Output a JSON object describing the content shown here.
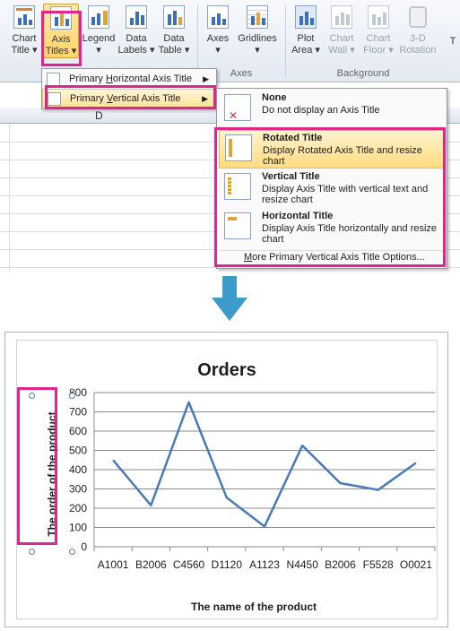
{
  "ribbon": {
    "buttons": [
      {
        "label1": "Chart",
        "label2": "Title ▾"
      },
      {
        "label1": "Axis",
        "label2": "Titles ▾"
      },
      {
        "label1": "Legend",
        "label2": "▾"
      },
      {
        "label1": "Data",
        "label2": "Labels ▾"
      },
      {
        "label1": "Data",
        "label2": "Table ▾"
      },
      {
        "label1": "Axes",
        "label2": "▾"
      },
      {
        "label1": "Gridlines",
        "label2": "▾"
      },
      {
        "label1": "Plot",
        "label2": "Area ▾"
      },
      {
        "label1": "Chart",
        "label2": "Wall ▾"
      },
      {
        "label1": "Chart",
        "label2": "Floor ▾"
      },
      {
        "label1": "3-D",
        "label2": "Rotation"
      },
      {
        "label1": "T",
        "label2": ""
      }
    ],
    "group_axes": "Axes",
    "group_background": "Background"
  },
  "sheet": {
    "column_header": "D"
  },
  "submenu": {
    "items": [
      {
        "label": "Primary Horizontal Axis Title",
        "mnemonic_prefix": "Primary ",
        "mnemonic": "H",
        "mnemonic_rest": "orizontal Axis Title"
      },
      {
        "label": "Primary Vertical Axis Title",
        "mnemonic_prefix": "Primary ",
        "mnemonic": "V",
        "mnemonic_rest": "ertical Axis Title"
      }
    ]
  },
  "flyout": {
    "options": [
      {
        "title": "None",
        "desc": "Do not display an Axis Title"
      },
      {
        "title": "Rotated Title",
        "desc": "Display Rotated Axis Title and resize chart"
      },
      {
        "title": "Vertical Title",
        "desc": "Display Axis Title with vertical text and resize chart"
      },
      {
        "title": "Horizontal Title",
        "desc": "Display Axis Title horizontally and resize chart"
      }
    ],
    "more_prefix": "",
    "more_mnemonic": "M",
    "more_rest": "ore Primary Vertical Axis Title Options..."
  },
  "colors": {
    "highlight": "#e0268a",
    "arrow": "#3d9bc9",
    "line": "#4a7ab5"
  },
  "chart_data": {
    "type": "line",
    "title": "Orders",
    "xlabel": "The name of the product",
    "ylabel": "The order of the product",
    "categories": [
      "A1001",
      "B2006",
      "C4560",
      "D1120",
      "A1123",
      "N4450",
      "B2006",
      "F5528",
      "O0021"
    ],
    "values": [
      450,
      215,
      750,
      255,
      105,
      525,
      330,
      295,
      435
    ],
    "ylim": [
      0,
      800
    ],
    "yticks": [
      0,
      100,
      200,
      300,
      400,
      500,
      600,
      700,
      800
    ],
    "grid": true,
    "legend": "none"
  }
}
